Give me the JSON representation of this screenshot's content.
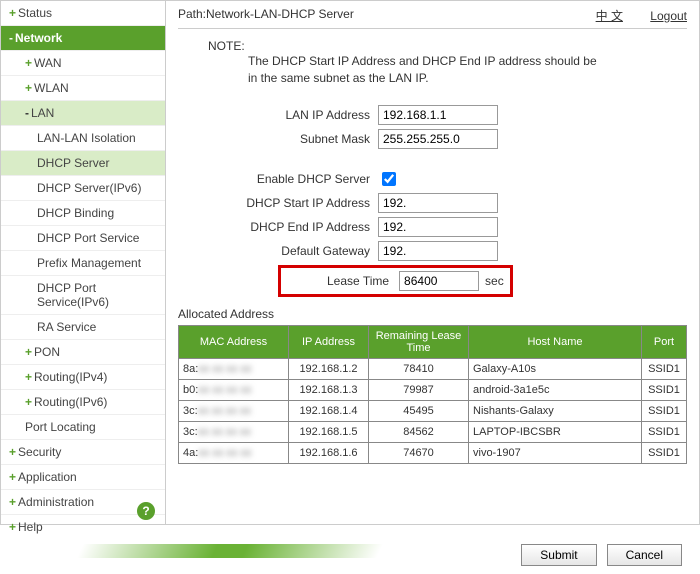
{
  "topbar": {
    "path": "Path:Network-LAN-DHCP Server",
    "lang": "中 文",
    "logout": "Logout"
  },
  "sidebar": {
    "status": "Status",
    "network": "Network",
    "wan": "WAN",
    "wlan": "WLAN",
    "lan": "LAN",
    "lan_items": {
      "lanlan": "LAN-LAN Isolation",
      "dhcp": "DHCP Server",
      "dhcp6": "DHCP Server(IPv6)",
      "bind": "DHCP Binding",
      "port": "DHCP Port Service",
      "prefix": "Prefix Management",
      "port6": "DHCP Port Service(IPv6)",
      "ra": "RA Service"
    },
    "pon": "PON",
    "r4": "Routing(IPv4)",
    "r6": "Routing(IPv6)",
    "ploc": "Port Locating",
    "security": "Security",
    "app": "Application",
    "admin": "Administration",
    "help": "Help"
  },
  "note": {
    "title": "NOTE:",
    "text": "The DHCP Start IP Address and DHCP End IP address should be in the same subnet as the LAN IP."
  },
  "form": {
    "lanip_label": "LAN IP Address",
    "lanip_value": "192.168.1.1",
    "subnet_label": "Subnet Mask",
    "subnet_value": "255.255.255.0",
    "enable_label": "Enable DHCP Server",
    "start_label": "DHCP Start IP Address",
    "start_value": "192.",
    "end_label": "DHCP End IP Address",
    "end_value": "192.",
    "gw_label": "Default Gateway",
    "gw_value": "192.",
    "lease_label": "Lease Time",
    "lease_value": "86400",
    "lease_unit": "sec"
  },
  "alloc": {
    "title": "Allocated Address",
    "headers": {
      "mac": "MAC Address",
      "ip": "IP Address",
      "rem": "Remaining Lease Time",
      "host": "Host Name",
      "port": "Port"
    },
    "rows": [
      {
        "mac": "8a:",
        "ip": "192.168.1.2",
        "rem": "78410",
        "host": "Galaxy-A10s",
        "port": "SSID1"
      },
      {
        "mac": "b0:",
        "ip": "192.168.1.3",
        "rem": "79987",
        "host": "android-3a1e5c",
        "port": "SSID1"
      },
      {
        "mac": "3c:",
        "ip": "192.168.1.4",
        "rem": "45495",
        "host": "Nishants-Galaxy",
        "port": "SSID1"
      },
      {
        "mac": "3c:",
        "ip": "192.168.1.5",
        "rem": "84562",
        "host": "LAPTOP-IBCSBR",
        "port": "SSID1"
      },
      {
        "mac": "4a:",
        "ip": "192.168.1.6",
        "rem": "74670",
        "host": "vivo-1907",
        "port": "SSID1"
      }
    ]
  },
  "footer": {
    "submit": "Submit",
    "cancel": "Cancel"
  }
}
